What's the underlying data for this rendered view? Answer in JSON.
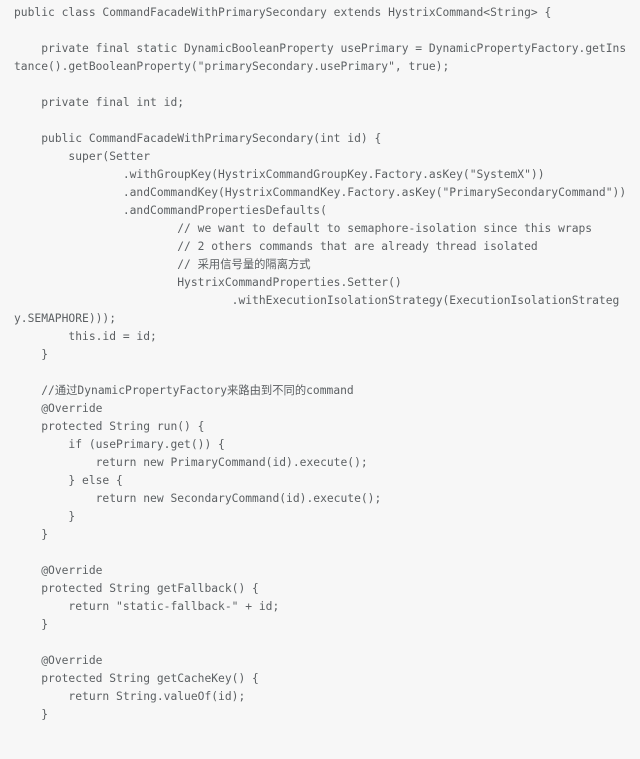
{
  "document": {
    "kind": "source-code-snippet",
    "language": "java",
    "class_name": "CommandFacadeWithPrimarySecondary",
    "colors": {
      "background": "#f7f7f7",
      "text": "#5c6063"
    },
    "code": "public class CommandFacadeWithPrimarySecondary extends HystrixCommand<String> {\n\n    private final static DynamicBooleanProperty usePrimary = DynamicPropertyFactory.getInstance().getBooleanProperty(\"primarySecondary.usePrimary\", true);\n\n    private final int id;\n\n    public CommandFacadeWithPrimarySecondary(int id) {\n        super(Setter\n                .withGroupKey(HystrixCommandGroupKey.Factory.asKey(\"SystemX\"))\n                .andCommandKey(HystrixCommandKey.Factory.asKey(\"PrimarySecondaryCommand\"))\n                .andCommandPropertiesDefaults(\n                        // we want to default to semaphore-isolation since this wraps\n                        // 2 others commands that are already thread isolated\n                        // 采用信号量的隔离方式\n                        HystrixCommandProperties.Setter()\n                                .withExecutionIsolationStrategy(ExecutionIsolationStrategy.SEMAPHORE)));\n        this.id = id;\n    }\n\n    //通过DynamicPropertyFactory来路由到不同的command\n    @Override\n    protected String run() {\n        if (usePrimary.get()) {\n            return new PrimaryCommand(id).execute();\n        } else {\n            return new SecondaryCommand(id).execute();\n        }\n    }\n\n    @Override\n    protected String getFallback() {\n        return \"static-fallback-\" + id;\n    }\n\n    @Override\n    protected String getCacheKey() {\n        return String.valueOf(id);\n    }\n"
  }
}
